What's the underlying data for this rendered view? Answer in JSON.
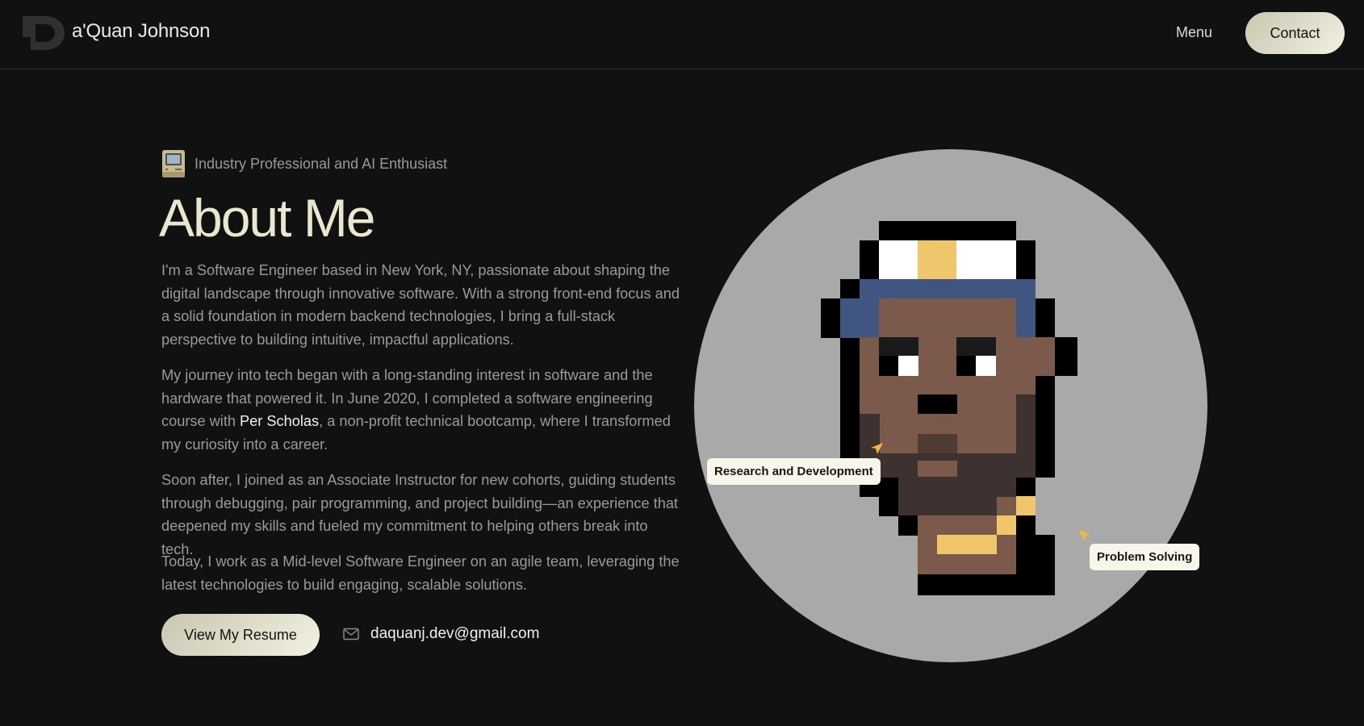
{
  "header": {
    "brand_name": "a'Quan Johnson",
    "menu_label": "Menu",
    "contact_label": "Contact"
  },
  "intro": {
    "tagline": "Industry Professional and AI Enthusiast",
    "tagline_icon": "computer-emoji",
    "title": "About Me"
  },
  "paragraphs": {
    "p1": "I'm a Software Engineer based in New York, NY, passionate about shaping the digital landscape through innovative software. With a strong front-end focus and a solid foundation in modern backend technologies, I bring a full-stack perspective to building intuitive, impactful applications.",
    "p2_before": "My journey into tech began with a long-standing interest in software and the hardware that powered it. In June 2020, I completed a software engineering course with ",
    "p2_link": "Per Scholas",
    "p2_after": ", a non-profit technical bootcamp, where I transformed my curiosity into a career.",
    "p3": "Soon after, I joined as an Associate Instructor for new cohorts, guiding students through debugging, pair programming, and project building—an experience that deepened my skills and fueled my commitment to helping others break into tech.",
    "p4": "Today, I work as a Mid-level Software Engineer on an agile team, leveraging the latest technologies to build engaging, scalable solutions."
  },
  "actions": {
    "resume_label": "View My Resume",
    "email": "daquanj.dev@gmail.com",
    "email_icon": "mail-icon"
  },
  "avatar": {
    "label_rd": "Research and Development",
    "label_ps": "Problem Solving"
  },
  "colors": {
    "background": "#101111",
    "accent_cream": "#f3f1e2",
    "circle": "#a9a9a9",
    "skin": "#7b5a4c",
    "beanie_blue": "#405582",
    "gold": "#efc66a"
  }
}
